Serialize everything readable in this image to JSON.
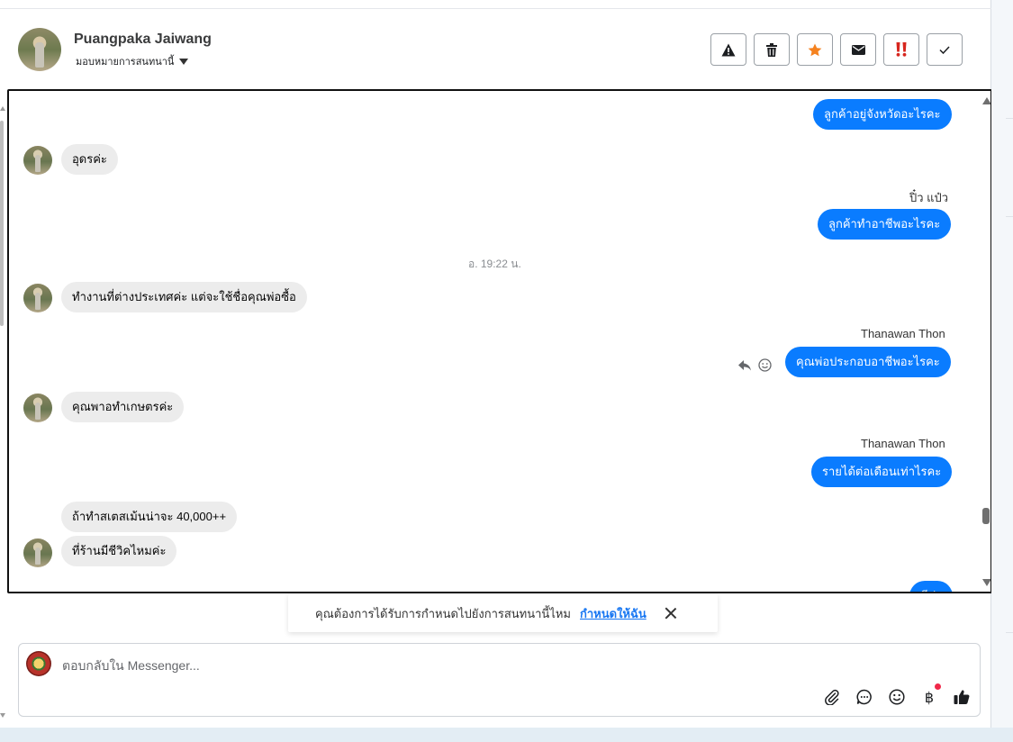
{
  "contact": {
    "name": "Puangpaka Jaiwang",
    "assign_label": "มอบหมายการสนทนานี้"
  },
  "actions": [
    {
      "name": "report-button",
      "icon": "warning-icon"
    },
    {
      "name": "delete-button",
      "icon": "trash-icon"
    },
    {
      "name": "star-button",
      "icon": "star-icon"
    },
    {
      "name": "mark-unread-button",
      "icon": "envelope-icon"
    },
    {
      "name": "mark-spam-button",
      "icon": "double-exclamation-icon"
    },
    {
      "name": "mark-done-button",
      "icon": "checkmark-icon"
    }
  ],
  "messages": {
    "m1": "ลูกค้าอยู่จังหวัดอะไรคะ",
    "m2": "อุดรค่ะ",
    "m3_sender": "ปิ๋ว แป๋ว",
    "m3": "ลูกค้าทำอาชีพอะไรคะ",
    "time1": "อ. 19:22 น.",
    "m4": "ทำงานที่ต่างประเทศค่ะ แต่จะใช้ชื่อคุณพ่อซื้อ",
    "m5_sender": "Thanawan Thon",
    "m5": "คุณพ่อประกอบอาชีพอะไรคะ",
    "m6": "คุณพาอทำเกษตรค่ะ",
    "m7_sender": "Thanawan Thon",
    "m7": "รายได้ต่อเดือนเท่าไรคะ",
    "m8": "ถ้าทำสเตสเม้นน่าจะ 40,000++",
    "m9": "ที่ร้านมีชีวิคไหมค่ะ",
    "m10": "มีค่ะ"
  },
  "assign_prompt": {
    "question": "คุณต้องการได้รับการกำหนดไปยังการสนทนานี้ไหม",
    "action": "กำหนดให้ฉัน"
  },
  "composer": {
    "placeholder": "ตอบกลับใน Messenger..."
  },
  "composer_tools": [
    "paperclip-icon",
    "saved-reply-icon",
    "emoji-icon",
    "baht-icon",
    "thumbs-up-icon"
  ],
  "colors": {
    "outgoing_bubble": "#0a7cff",
    "incoming_bubble": "#ececec",
    "star": "#f5821f",
    "spam": "#d7261e",
    "notification_dot": "#f02849"
  }
}
